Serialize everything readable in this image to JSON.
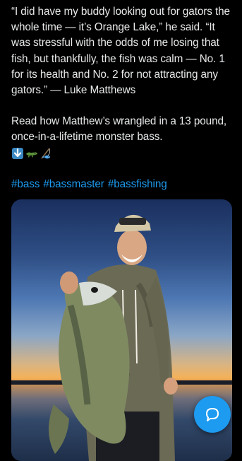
{
  "post": {
    "paragraph1": "“I did have my buddy looking out for gators the whole time — it’s Orange Lake,” he said. “It was stressful with the odds of me losing that fish, but thankfully, the fish was calm — No. 1 for its health and No. 2 for not attracting any gators.” — Luke Matthews",
    "paragraph2": "Read how Matthew’s wrangled in a 13 pound, once-in-a-lifetime monster bass.",
    "emojis": [
      "down-arrow-icon",
      "alligator-icon",
      "fishing-icon"
    ],
    "hashtags": [
      "#bass",
      "#bassmaster",
      "#bassfishing"
    ]
  },
  "colors": {
    "background": "#000000",
    "text": "#e7e9ea",
    "link": "#1d9bf0",
    "fab": "#1d9bf0"
  },
  "media": {
    "icon": "photo-of-angler-holding-largemouth-bass-at-sunset"
  },
  "fab": {
    "icon": "compose-message-icon"
  }
}
